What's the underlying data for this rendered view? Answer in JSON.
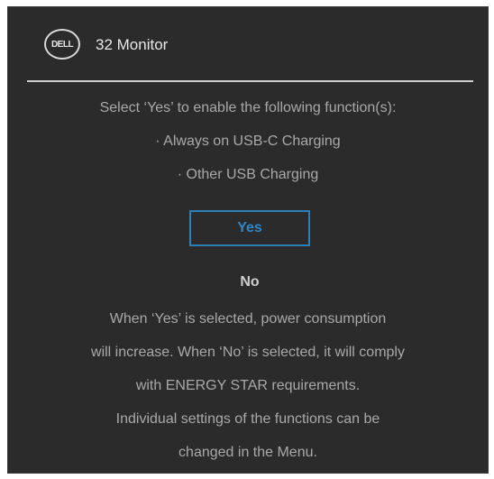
{
  "header": {
    "logo_text": "DELL",
    "title": "32 Monitor"
  },
  "dialog": {
    "prompt": "Select ‘Yes’ to enable the following function(s):",
    "functions": [
      "·  Always on USB-C Charging",
      "·  Other  USB Charging"
    ],
    "yes_label": "Yes",
    "no_label": "No",
    "info_lines": [
      "When ‘Yes’ is selected, power consumption",
      "will increase. When ‘No’ is selected, it will comply",
      "with ENERGY STAR requirements.",
      "Individual settings of the functions can be",
      "changed in the Menu."
    ]
  },
  "colors": {
    "background": "#2b2b2b",
    "accent": "#2f86c8",
    "text": "#a9a9a9"
  }
}
